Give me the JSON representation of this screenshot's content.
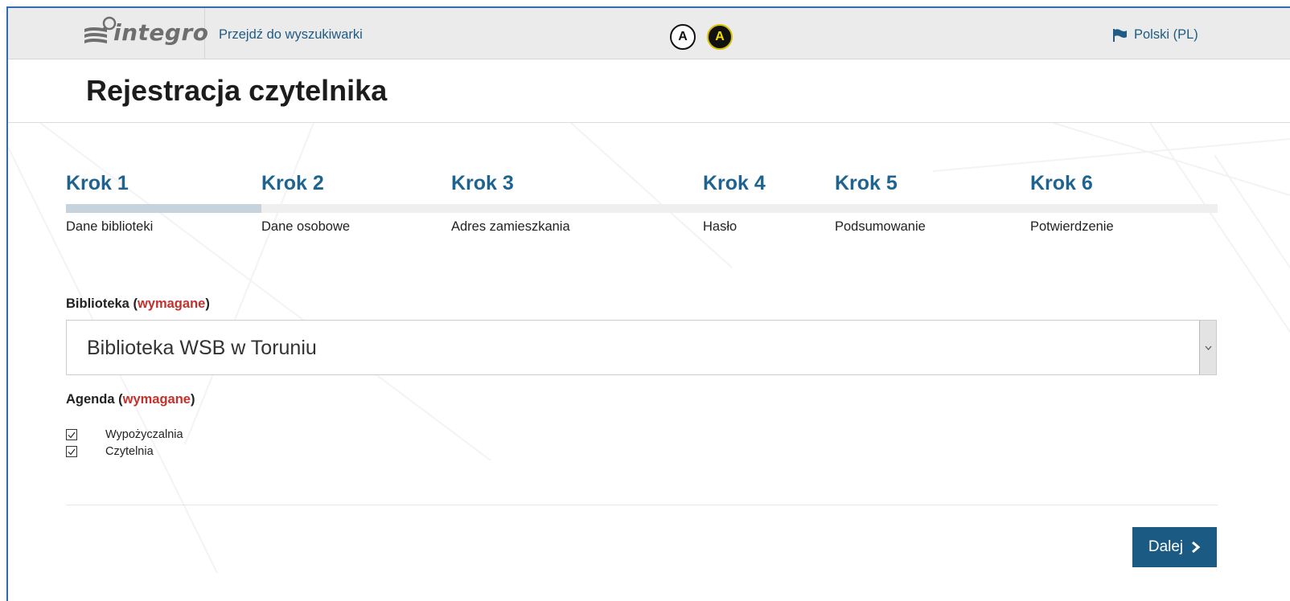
{
  "header": {
    "logo_text": "integro",
    "skip_link": "Przejdź do wyszukiwarki",
    "contrast_normal": "A",
    "contrast_high": "A",
    "language": "Polski (PL)",
    "flag_icon": "flag-icon"
  },
  "page": {
    "title": "Rejestracja czytelnika"
  },
  "steps": {
    "progress": 1,
    "total": 6,
    "items": [
      {
        "num": "Krok 1",
        "label": "Dane biblioteki"
      },
      {
        "num": "Krok 2",
        "label": "Dane osobowe"
      },
      {
        "num": "Krok 3",
        "label": "Adres zamieszkania"
      },
      {
        "num": "Krok 4",
        "label": "Hasło"
      },
      {
        "num": "Krok 5",
        "label": "Podsumowanie"
      },
      {
        "num": "Krok 6",
        "label": "Potwierdzenie"
      }
    ]
  },
  "form": {
    "library_label": "Biblioteka",
    "library_required": "wymagane",
    "library_value": "Biblioteka WSB w Toruniu",
    "agenda_label": "Agenda",
    "agenda_required": "wymagane",
    "agenda_options": [
      {
        "label": "Wypożyczalnia",
        "checked": true
      },
      {
        "label": "Czytelnia",
        "checked": true
      }
    ]
  },
  "footer": {
    "next_label": "Dalej"
  },
  "colors": {
    "accent": "#1b5a82",
    "step_title": "#1f6390",
    "required": "#c4302b"
  }
}
